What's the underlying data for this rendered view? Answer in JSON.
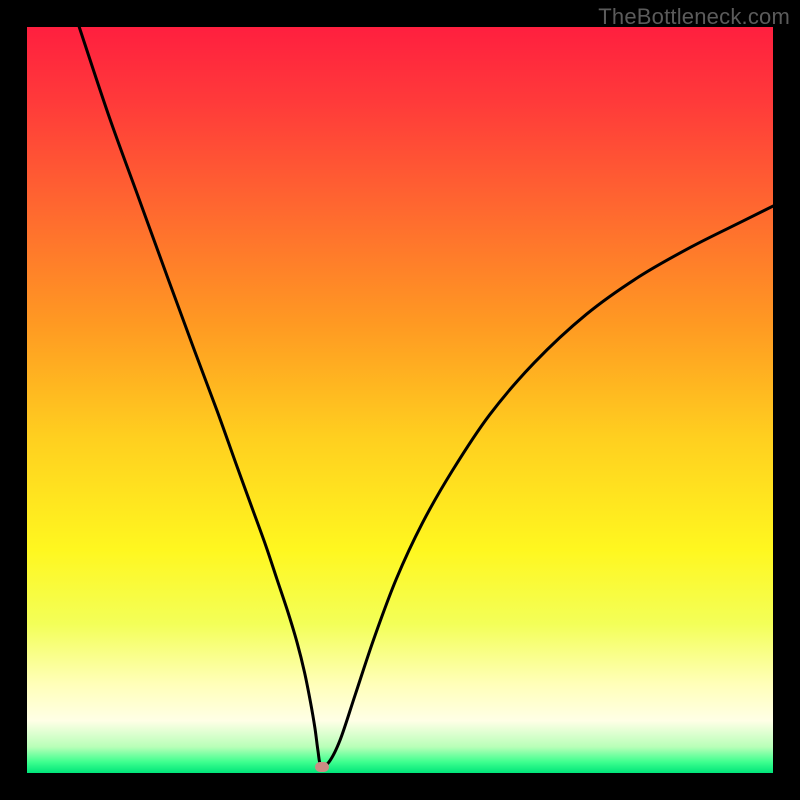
{
  "watermark": "TheBottleneck.com",
  "colors": {
    "frame": "#000000",
    "gradient_stops": [
      {
        "offset": 0.0,
        "color": "#ff1f3f"
      },
      {
        "offset": 0.1,
        "color": "#ff3a3a"
      },
      {
        "offset": 0.25,
        "color": "#ff6a2f"
      },
      {
        "offset": 0.4,
        "color": "#ff9a22"
      },
      {
        "offset": 0.55,
        "color": "#ffcf1f"
      },
      {
        "offset": 0.7,
        "color": "#fff71f"
      },
      {
        "offset": 0.8,
        "color": "#f3ff58"
      },
      {
        "offset": 0.88,
        "color": "#ffffb8"
      },
      {
        "offset": 0.93,
        "color": "#ffffe6"
      },
      {
        "offset": 0.965,
        "color": "#b8ffb8"
      },
      {
        "offset": 0.985,
        "color": "#3fff8f"
      },
      {
        "offset": 1.0,
        "color": "#00e57a"
      }
    ],
    "curve": "#000000",
    "marker": "#cc8b84"
  },
  "chart_data": {
    "type": "line",
    "title": "",
    "xlabel": "",
    "ylabel": "",
    "xlim": [
      0,
      100
    ],
    "ylim": [
      0,
      100
    ],
    "x": [
      7.0,
      11.0,
      15.0,
      19.0,
      22.5,
      25.5,
      28.0,
      30.0,
      32.0,
      33.5,
      35.0,
      36.2,
      37.2,
      38.0,
      38.6,
      39.0,
      39.4,
      40.5,
      42.0,
      44.0,
      46.5,
      49.5,
      53.0,
      57.0,
      62.0,
      68.0,
      75.0,
      82.0,
      89.0,
      96.0,
      100.0
    ],
    "values": [
      100.0,
      88.0,
      77.0,
      66.0,
      56.5,
      48.5,
      41.5,
      36.0,
      30.5,
      26.0,
      21.5,
      17.5,
      13.5,
      9.5,
      6.0,
      3.0,
      1.0,
      1.5,
      4.5,
      10.5,
      18.0,
      26.0,
      33.5,
      40.5,
      48.0,
      55.0,
      61.5,
      66.5,
      70.5,
      74.0,
      76.0
    ],
    "marker": {
      "x": 39.5,
      "y": 0.8
    }
  }
}
